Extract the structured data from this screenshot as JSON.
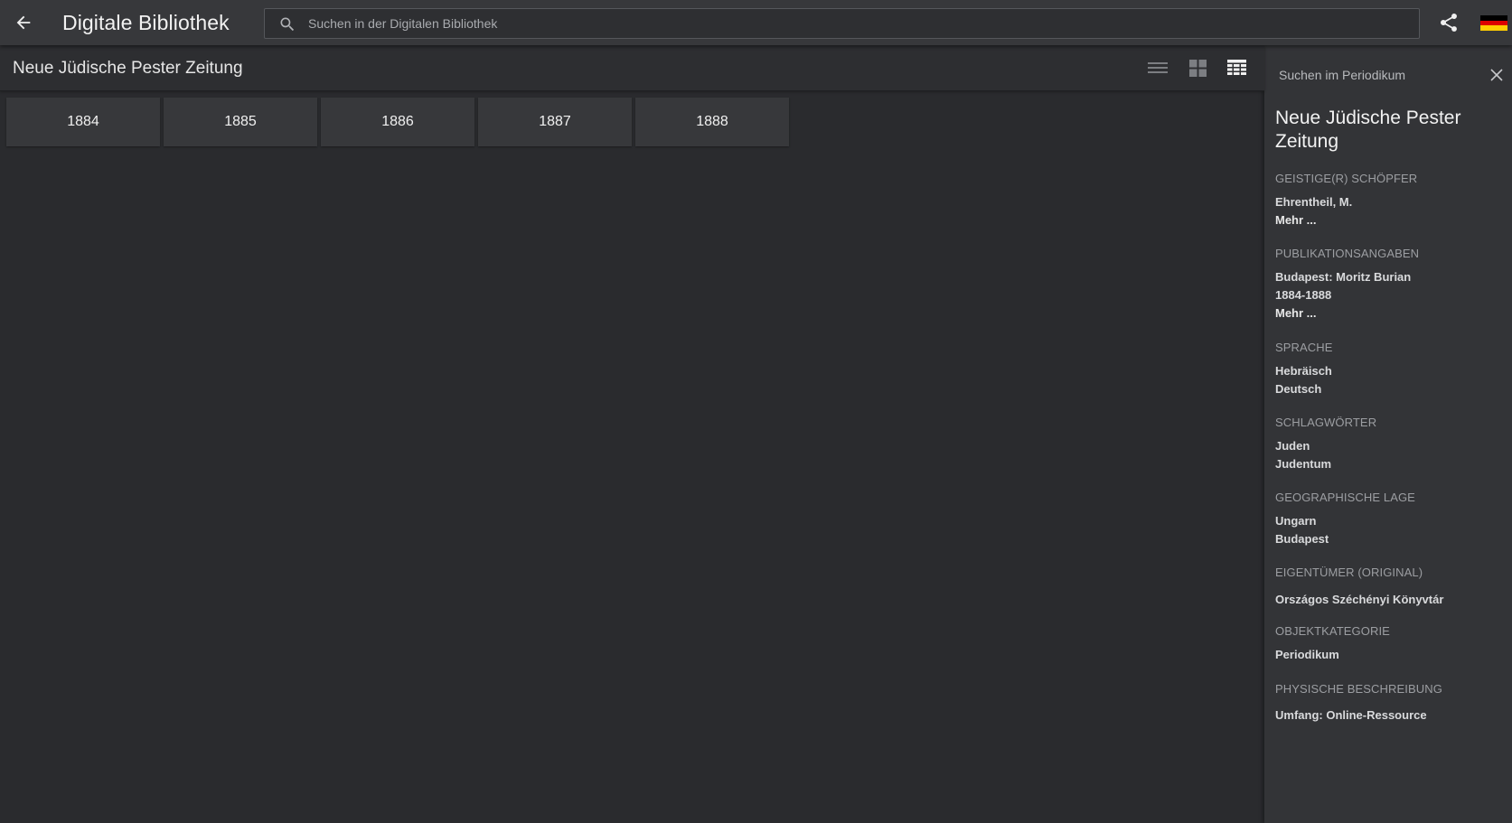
{
  "topbar": {
    "title": "Digitale Bibliothek",
    "search_placeholder": "Suchen in der Digitalen Bibliothek",
    "search_value": "",
    "icons": {
      "back": "arrow-left-icon",
      "search": "search-icon",
      "share": "share-icon",
      "language": "german-flag-icon"
    },
    "flag_colors": [
      "#000000",
      "#dd0000",
      "#ffce00"
    ]
  },
  "subbar": {
    "title": "Neue Jüdische Pester Zeitung",
    "views": [
      "list-view-icon",
      "grid-view-icon",
      "table-view-icon"
    ],
    "active_view": "table-view-icon"
  },
  "years": [
    "1884",
    "1885",
    "1886",
    "1887",
    "1888"
  ],
  "sidepanel": {
    "search_label": "Suchen im Periodikum",
    "title": "Neue Jüdische Pester Zeitung",
    "groups": [
      {
        "heading": "Geistige(r) Schöpfer",
        "values": [
          "Ehrentheil, M."
        ],
        "more": "Mehr ..."
      },
      {
        "heading": "Publikationsangaben",
        "values": [
          "Budapest: Moritz Burian",
          "1884-1888"
        ],
        "more": "Mehr ..."
      },
      {
        "heading": "Sprache",
        "values": [
          "Hebräisch",
          "Deutsch"
        ]
      },
      {
        "heading": "Schlagwörter",
        "values": [
          "Juden",
          "Judentum"
        ]
      },
      {
        "heading": "Geographische Lage",
        "values": [
          "Ungarn",
          "Budapest"
        ]
      },
      {
        "heading": "Eigentümer (Original)",
        "values": [
          "Országos Széchényi Könyvtár"
        ]
      },
      {
        "heading": "Objektkategorie",
        "values": [
          "Periodikum"
        ]
      },
      {
        "heading": "Physische Beschreibung",
        "values": [
          "Umfang: Online-Ressource"
        ]
      }
    ]
  },
  "colors": {
    "background": "#2a2b2e",
    "topbar": "#37383b",
    "tile": "#37383b",
    "panel": "#333437"
  }
}
